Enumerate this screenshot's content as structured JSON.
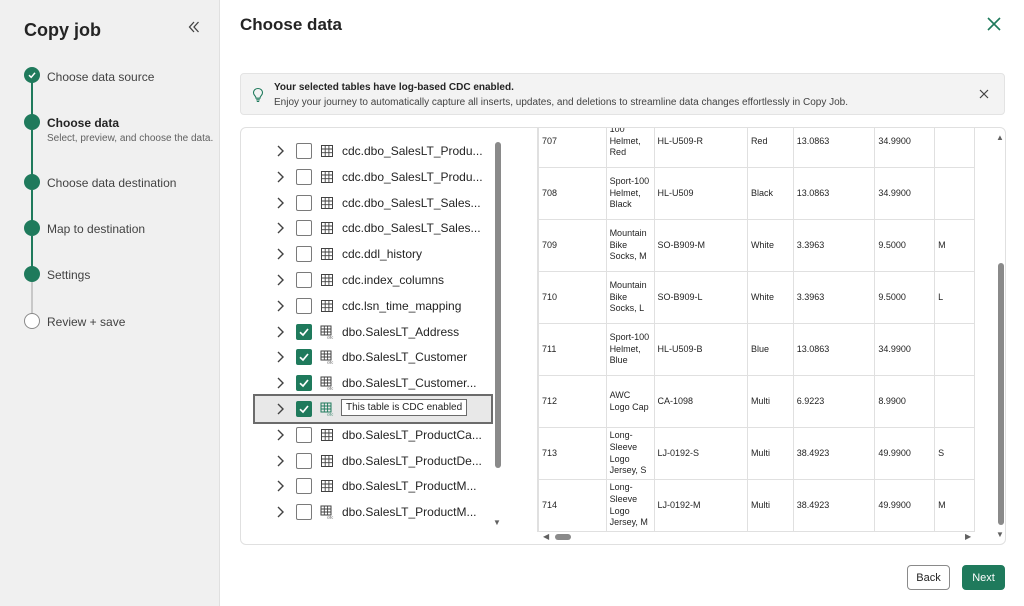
{
  "left_panel": {
    "title": "Copy job",
    "collapse_icon": "double-chevron-left-icon",
    "steps": [
      {
        "label": "Choose data source",
        "state": "done"
      },
      {
        "label": "Choose data",
        "state": "active",
        "subtitle": "Select, preview, and choose the data."
      },
      {
        "label": "Choose data destination",
        "state": "pending"
      },
      {
        "label": "Map to destination",
        "state": "pending"
      },
      {
        "label": "Settings",
        "state": "pending"
      },
      {
        "label": "Review + save",
        "state": "empty"
      }
    ]
  },
  "main": {
    "title": "Choose data",
    "banner": {
      "title": "Your selected tables have log-based CDC enabled.",
      "text": "Enjoy your journey to automatically capture all inserts, updates, and deletions to streamline data changes effortlessly in Copy Job."
    },
    "tree": {
      "items": [
        {
          "label": "cdc.dbo_SalesLT_Produ...",
          "checked": false,
          "icon": "table-icon"
        },
        {
          "label": "cdc.dbo_SalesLT_Produ...",
          "checked": false,
          "icon": "table-icon"
        },
        {
          "label": "cdc.dbo_SalesLT_Sales...",
          "checked": false,
          "icon": "table-icon"
        },
        {
          "label": "cdc.dbo_SalesLT_Sales...",
          "checked": false,
          "icon": "table-icon"
        },
        {
          "label": "cdc.ddl_history",
          "checked": false,
          "icon": "table-icon"
        },
        {
          "label": "cdc.index_columns",
          "checked": false,
          "icon": "table-icon"
        },
        {
          "label": "cdc.lsn_time_mapping",
          "checked": false,
          "icon": "table-icon"
        },
        {
          "label": "dbo.SalesLT_Address",
          "checked": true,
          "icon": "cdc-table-icon"
        },
        {
          "label": "dbo.SalesLT_Customer",
          "checked": true,
          "icon": "cdc-table-icon"
        },
        {
          "label": "dbo.SalesLT_Customer...",
          "checked": true,
          "icon": "cdc-table-icon"
        },
        {
          "label": "",
          "checked": true,
          "icon": "cdc-table-icon",
          "tooltip": "This table is CDC enabled"
        },
        {
          "label": "dbo.SalesLT_ProductCa...",
          "checked": false,
          "icon": "table-icon"
        },
        {
          "label": "dbo.SalesLT_ProductDe...",
          "checked": false,
          "icon": "table-icon"
        },
        {
          "label": "dbo.SalesLT_ProductM...",
          "checked": false,
          "icon": "table-icon"
        },
        {
          "label": "dbo.SalesLT_ProductM...",
          "checked": false,
          "icon": "cdc-table-icon"
        }
      ]
    },
    "table": {
      "rows": [
        [
          "707",
          "100 Helmet, Red",
          "HL-U509-R",
          "Red",
          "13.0863",
          "34.9900",
          ""
        ],
        [
          "708",
          "Sport-100 Helmet, Black",
          "HL-U509",
          "Black",
          "13.0863",
          "34.9900",
          ""
        ],
        [
          "709",
          "Mountain Bike Socks, M",
          "SO-B909-M",
          "White",
          "3.3963",
          "9.5000",
          "M"
        ],
        [
          "710",
          "Mountain Bike Socks, L",
          "SO-B909-L",
          "White",
          "3.3963",
          "9.5000",
          "L"
        ],
        [
          "711",
          "Sport-100 Helmet, Blue",
          "HL-U509-B",
          "Blue",
          "13.0863",
          "34.9900",
          ""
        ],
        [
          "712",
          "AWC Logo Cap",
          "CA-1098",
          "Multi",
          "6.9223",
          "8.9900",
          ""
        ],
        [
          "713",
          "Long-Sleeve Logo Jersey, S",
          "LJ-0192-S",
          "Multi",
          "38.4923",
          "49.9900",
          "S"
        ],
        [
          "714",
          "Long-Sleeve Logo Jersey, M",
          "LJ-0192-M",
          "Multi",
          "38.4923",
          "49.9900",
          "M"
        ]
      ]
    },
    "buttons": {
      "back": "Back",
      "next": "Next"
    },
    "colors": {
      "accent": "#1f7a5c"
    }
  }
}
